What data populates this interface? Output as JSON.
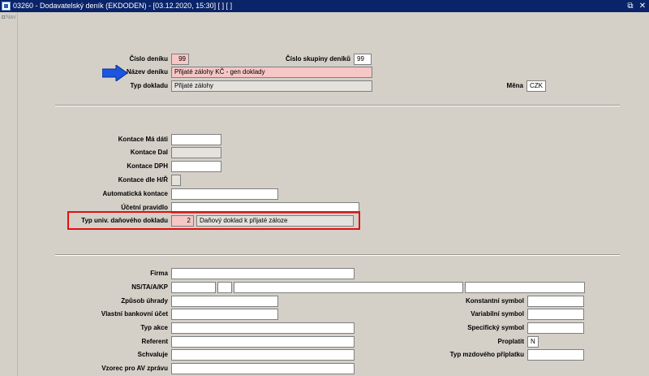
{
  "window": {
    "title": "03260 - Dodavatelský deník (EKDODEN) - [03.12.2020, 15:30]  [ ]  [ ]",
    "restore_glyph": "⧉",
    "close_glyph": "✕"
  },
  "nav": {
    "label": "Nav"
  },
  "header": {
    "cislo_deniku": {
      "label": "Číslo deníku",
      "value": "99"
    },
    "cislo_skupiny": {
      "label": "Číslo skupiny deníků",
      "value": "99"
    },
    "nazev_deniku": {
      "label": "Název deníku",
      "value": "Přijaté zálohy KČ - gen doklady"
    },
    "typ_dokladu": {
      "label": "Typ dokladu",
      "value": "Přijaté zálohy"
    },
    "mena": {
      "label": "Měna",
      "value": "CZK"
    }
  },
  "accounting": {
    "kontace_ma_dati": {
      "label": "Kontace Má dáti",
      "value": ""
    },
    "kontace_dal": {
      "label": "Kontace Dal",
      "value": ""
    },
    "kontace_dph": {
      "label": "Kontace DPH",
      "value": ""
    },
    "kontace_hr": {
      "label": "Kontace dle H/Ř",
      "value": ""
    },
    "automaticka_kontace": {
      "label": "Automatická kontace",
      "value": ""
    },
    "ucetni_pravidlo": {
      "label": "Účetní pravidlo",
      "value": ""
    },
    "typ_univ_dokladu": {
      "label": "Typ univ. daňového dokladu",
      "code": "2",
      "text": "Daňový doklad k přijaté záloze"
    }
  },
  "details": {
    "firma": {
      "label": "Firma",
      "value": ""
    },
    "ns": {
      "label": "NS/TA/A/KP",
      "value": ""
    },
    "zpusob_uhrady": {
      "label": "Způsob úhrady",
      "value": ""
    },
    "vlastni_ucet": {
      "label": "Vlastní bankovní účet",
      "value": ""
    },
    "typ_akce": {
      "label": "Typ akce",
      "value": ""
    },
    "referent": {
      "label": "Referent",
      "value": ""
    },
    "schvaluje": {
      "label": "Schvaluje",
      "value": ""
    },
    "vzorec": {
      "label": "Vzorec pro AV zprávu",
      "value": ""
    },
    "konstantni_symbol": {
      "label": "Konstantní symbol",
      "value": ""
    },
    "variabilni_symbol": {
      "label": "Variabilní symbol",
      "value": ""
    },
    "specificky_symbol": {
      "label": "Specifický symbol",
      "value": ""
    },
    "proplatit": {
      "label": "Proplatit",
      "value": "N"
    },
    "typ_mzdoveho": {
      "label": "Typ mzdového příplatku",
      "value": ""
    }
  },
  "colors": {
    "highlight_pink": "#f7c6c6",
    "annotation_red": "#e01010",
    "annotation_arrow": "#1b55e0",
    "titlebar": "#0a246a"
  }
}
